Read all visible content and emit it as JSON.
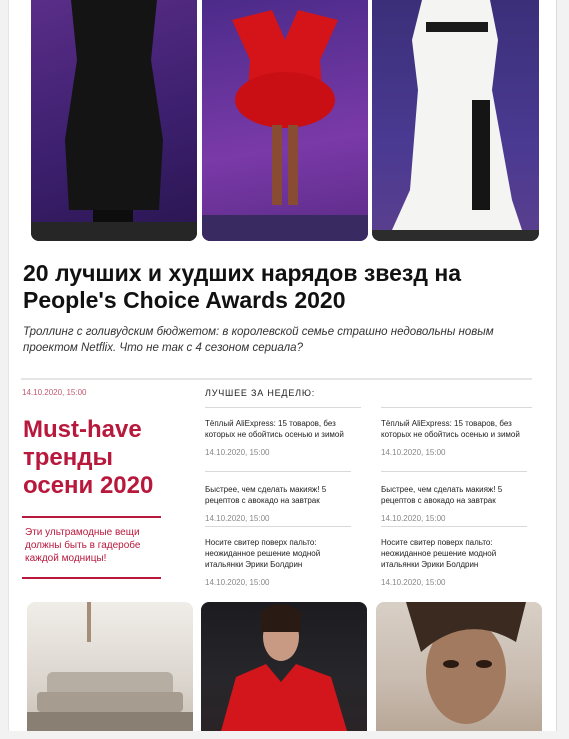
{
  "article": {
    "title": "20 лучших и худших нарядов звезд на People's Choice Awards 2020",
    "lead": "Троллинг с голивудским бюджетом: в королевской семье страшно недовольны новым проектом Netflix. Что не так с 4 сезоном сериала?"
  },
  "promo": {
    "date": "14.10.2020, 15:00",
    "headline": "Must-have тренды осени 2020",
    "text": "Эти ультрамодные вещи должны быть в гадеробе каждой модницы!"
  },
  "best": {
    "label": "ЛУЧШЕЕ ЗА НЕДЕЛЮ:",
    "col1": [
      {
        "title": "Тёплый AliExpress: 15 товаров, без которых не обойтись осенью и зимой",
        "date": "14.10.2020, 15:00"
      },
      {
        "title": "Быстрее, чем сделать макияж! 5 рецептов с авокадо на завтрак",
        "date": "14.10.2020, 15:00"
      },
      {
        "title": "Носите свитер поверх пальто: неожиданное решение модной итальянки Эрики Болдрин",
        "date": "14.10.2020, 15:00"
      }
    ],
    "col2": [
      {
        "title": "Тёплый AliExpress: 15 товаров, без которых не обойтись осенью и зимой",
        "date": "14.10.2020, 15:00"
      },
      {
        "title": "Быстрее, чем сделать макияж! 5 рецептов с авокадо на завтрак",
        "date": "14.10.2020, 15:00"
      },
      {
        "title": "Носите свитер поверх пальто: неожиданное решение модной итальянки Эрики Болдрин",
        "date": "14.10.2020, 15:00"
      }
    ]
  },
  "colors": {
    "accent": "#b8183c"
  }
}
